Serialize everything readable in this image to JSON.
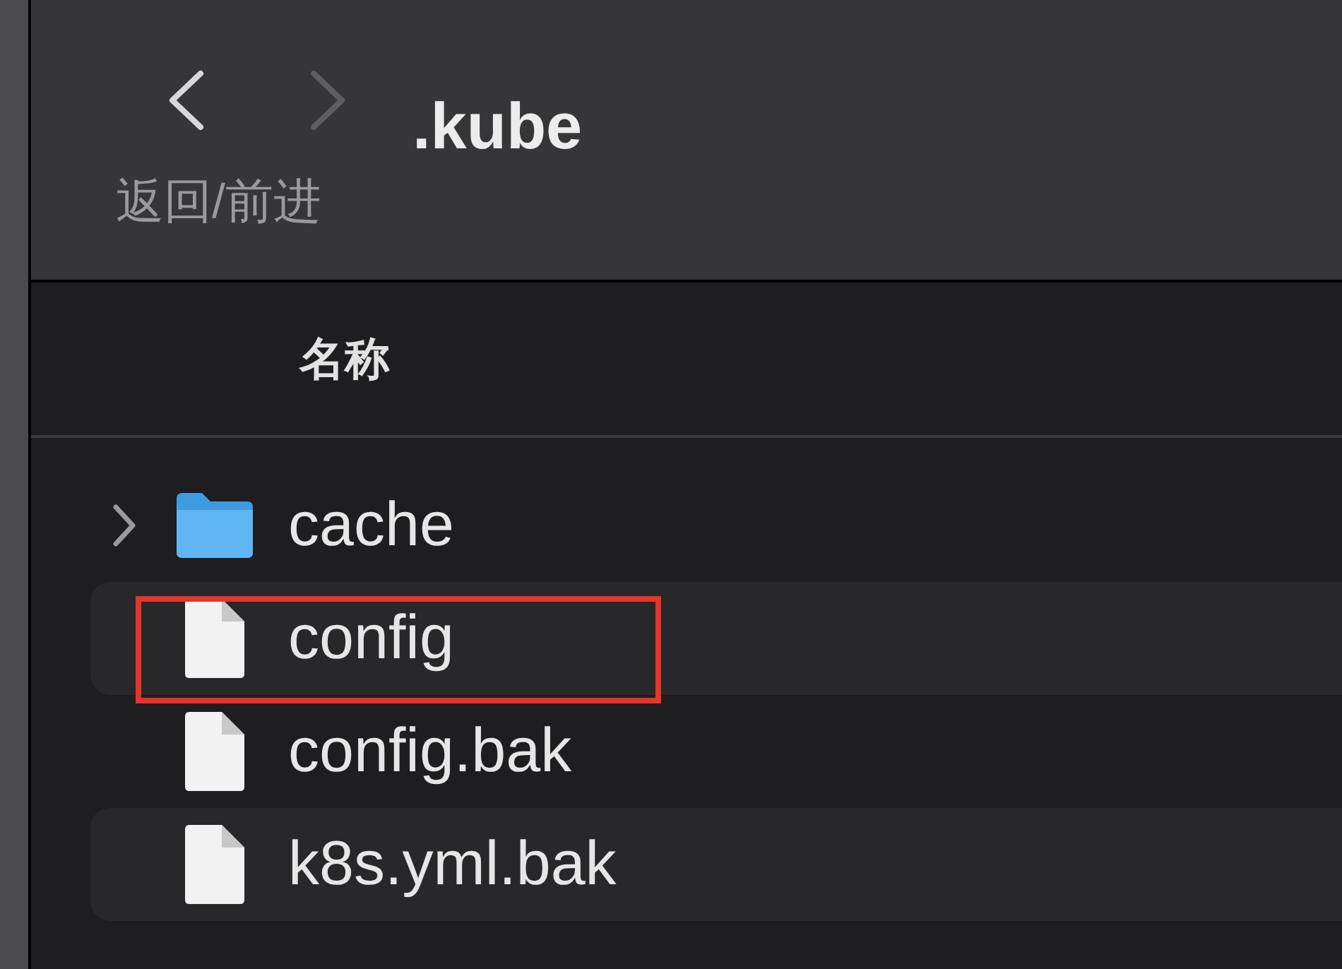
{
  "toolbar": {
    "back": {
      "disabled": false
    },
    "forward": {
      "disabled": true
    },
    "nav_label": "返回/前进",
    "title": ".kube"
  },
  "list": {
    "column_header": "名称",
    "rows": [
      {
        "kind": "folder",
        "name": "cache",
        "expanded": false,
        "highlighted": false
      },
      {
        "kind": "file",
        "name": "config",
        "highlighted": true
      },
      {
        "kind": "file",
        "name": "config.bak",
        "highlighted": false
      },
      {
        "kind": "file",
        "name": "k8s.yml.bak",
        "highlighted": false
      }
    ]
  }
}
